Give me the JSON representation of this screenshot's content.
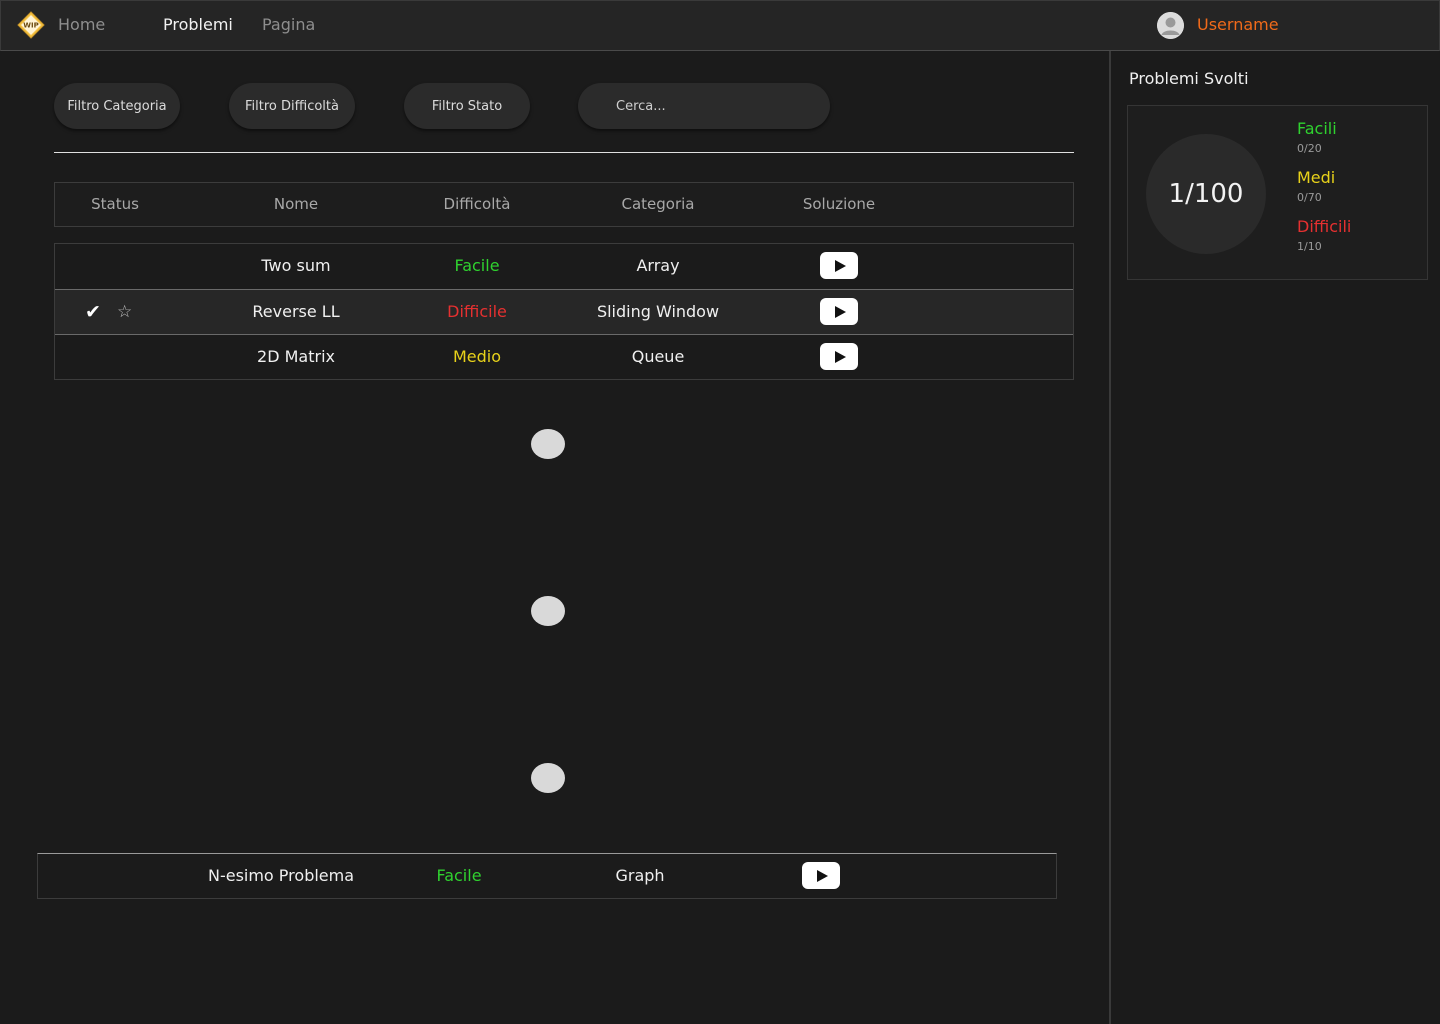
{
  "nav": {
    "logo_text": "WIP",
    "links": [
      {
        "label": "Home",
        "active": false
      },
      {
        "label": "Problemi",
        "active": true
      },
      {
        "label": "Pagina",
        "active": false
      }
    ],
    "username": "Username"
  },
  "filters": {
    "category": "Filtro Categoria",
    "difficulty": "Filtro Difficoltà",
    "status": "Filtro Stato",
    "search_placeholder": "Cerca..."
  },
  "table": {
    "columns": [
      "Status",
      "Nome",
      "Difficoltà",
      "Categoria",
      "Soluzione"
    ],
    "rows": [
      {
        "solved": false,
        "name": "Two sum",
        "difficulty": "Facile",
        "difficulty_color": "#2fd22f",
        "category": "Array"
      },
      {
        "solved": true,
        "name": "Reverse LL",
        "difficulty": "Difficile",
        "difficulty_color": "#e53030",
        "category": "Sliding Window"
      },
      {
        "solved": false,
        "name": "2D Matrix",
        "difficulty": "Medio",
        "difficulty_color": "#e8d21a",
        "category": "Queue"
      }
    ],
    "last_row": {
      "name": "N-esimo Problema",
      "difficulty": "Facile",
      "difficulty_color": "#2fd22f",
      "category": "Graph"
    }
  },
  "sidebar": {
    "title": "Problemi Svolti",
    "total": "1/100",
    "stats": [
      {
        "label": "Facili",
        "count": "0/20",
        "color": "#2fd22f"
      },
      {
        "label": "Medi",
        "count": "0/70",
        "color": "#e8d21a"
      },
      {
        "label": "Difficili",
        "count": "1/10",
        "color": "#e53030"
      }
    ]
  },
  "colors": {
    "accent": "#f06a1a",
    "background": "#1b1b1b",
    "easy": "#2fd22f",
    "medium": "#e8d21a",
    "hard": "#e53030"
  }
}
